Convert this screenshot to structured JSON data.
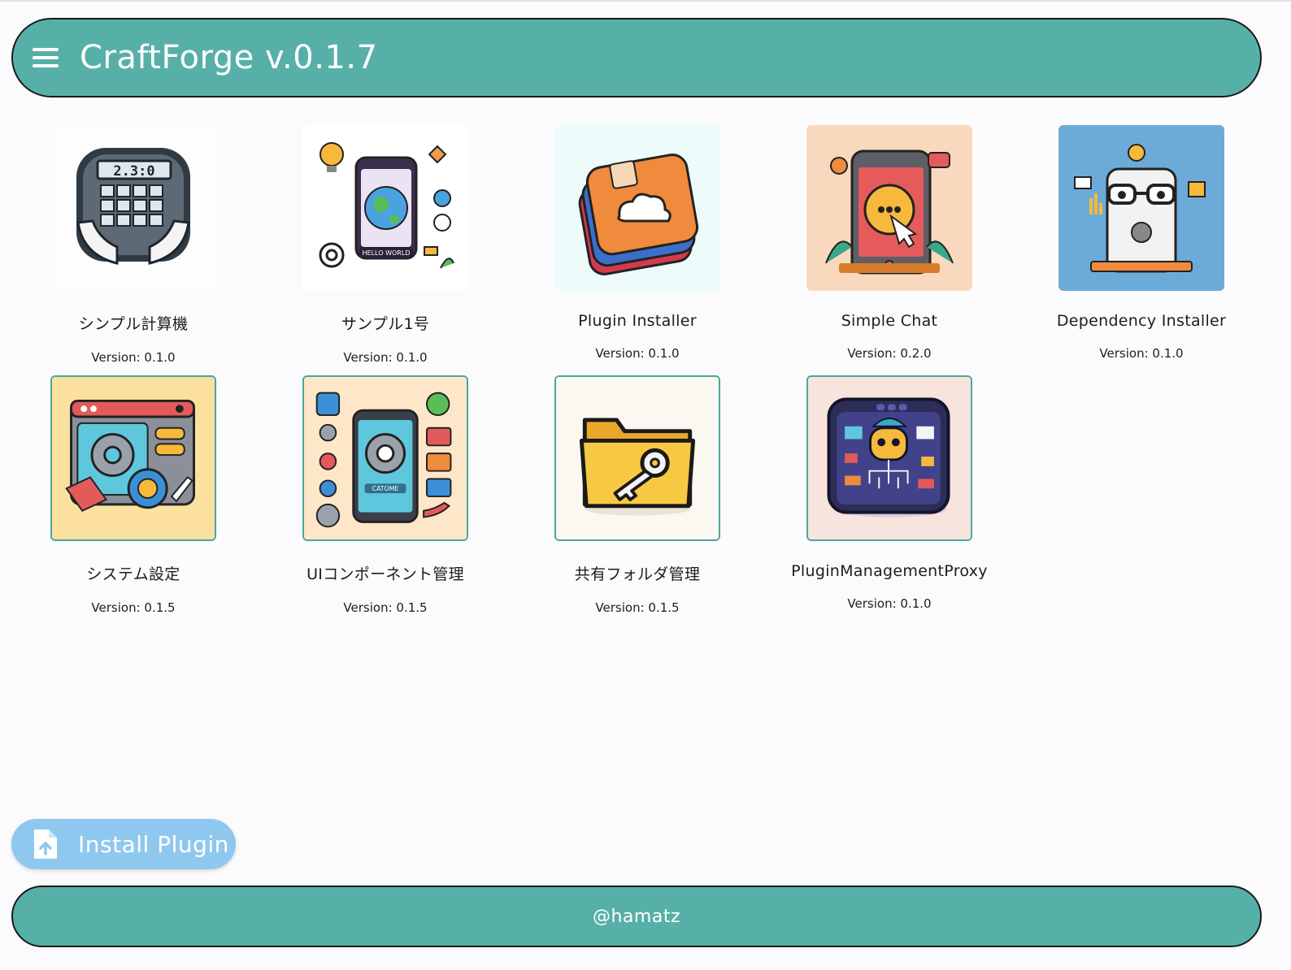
{
  "header": {
    "title": "CraftForge v.0.1.7",
    "menu_icon": "hamburger-menu-icon"
  },
  "plugins": [
    {
      "name": "シンプル計算機",
      "version": "Version: 0.1.0",
      "icon": "calculator-icon"
    },
    {
      "name": "サンプル1号",
      "version": "Version: 0.1.0",
      "icon": "hello-world-phone-icon"
    },
    {
      "name": "Plugin Installer",
      "version": "Version: 0.1.0",
      "icon": "app-stack-cloud-icon"
    },
    {
      "name": "Simple Chat",
      "version": "Version: 0.2.0",
      "icon": "chat-phone-icon"
    },
    {
      "name": "Dependency Installer",
      "version": "Version: 0.1.0",
      "icon": "robot-phone-tools-icon"
    },
    {
      "name": "システム設定",
      "version": "Version: 0.1.5",
      "icon": "settings-gear-window-icon"
    },
    {
      "name": "UIコンポーネント管理",
      "version": "Version: 0.1.5",
      "icon": "ui-components-gear-icon"
    },
    {
      "name": "共有フォルダ管理",
      "version": "Version: 0.1.5",
      "icon": "folder-key-icon"
    },
    {
      "name": "PluginManagementProxy",
      "version": "Version: 0.1.0",
      "icon": "robot-dashboard-icon"
    }
  ],
  "install_button": {
    "label": "Install Plugin",
    "icon": "file-upload-icon"
  },
  "footer": {
    "text": "@hamatz"
  },
  "colors": {
    "accent": "#57b0a8",
    "install_button": "#8fc8ee",
    "tile_border": "#4aa79d"
  }
}
